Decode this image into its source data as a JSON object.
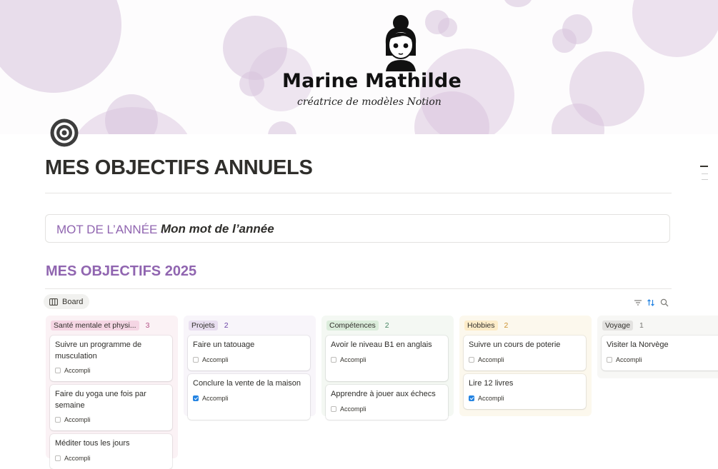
{
  "cover": {
    "logo_name": "Marine Mathilde",
    "logo_tagline": "créatrice de modèles Notion",
    "bubble_color": "#d7c2dc"
  },
  "page": {
    "icon": "target-icon",
    "title": "MES OBJECTIFS ANNUELS"
  },
  "callout": {
    "label": "MOT DE L’ANNÉE :",
    "value": "Mon mot de l’année"
  },
  "section": {
    "heading": "MES OBJECTIFS 2025",
    "accent_color": "#9065b0"
  },
  "view": {
    "tab_label": "Board",
    "tab_icon": "board-icon",
    "tools": [
      "filter-icon",
      "sort-icon",
      "search-icon"
    ]
  },
  "columns": [
    {
      "name": "Santé mentale et physi...",
      "count": "3",
      "tag_bg": "#f5d6e4",
      "col_bg": "#fbf2f5",
      "count_color": "#b35488",
      "cards": [
        {
          "title": "Suivre un programme de musculation",
          "check_label": "Accompli",
          "checked": false
        },
        {
          "title": "Faire du yoga une fois par semaine",
          "check_label": "Accompli",
          "checked": false
        },
        {
          "title": "Méditer tous les jours",
          "check_label": "Accompli",
          "checked": false
        }
      ]
    },
    {
      "name": "Projets",
      "count": "2",
      "tag_bg": "#e8def0",
      "col_bg": "#f8f5fa",
      "count_color": "#6940a5",
      "cards": [
        {
          "title": "Faire un tatouage",
          "check_label": "Accompli",
          "checked": false
        },
        {
          "title": "Conclure la vente de la maison",
          "check_label": "Accompli",
          "checked": true
        }
      ]
    },
    {
      "name": "Compétences",
      "count": "2",
      "tag_bg": "#dbeddb",
      "col_bg": "#f4f8f3",
      "count_color": "#448361",
      "cards": [
        {
          "title": "Avoir le niveau B1 en anglais",
          "check_label": "Accompli",
          "checked": false
        },
        {
          "title": "Apprendre à jouer aux échecs",
          "check_label": "Accompli",
          "checked": false
        }
      ]
    },
    {
      "name": "Hobbies",
      "count": "2",
      "tag_bg": "#fdecc8",
      "col_bg": "#fcf8ed",
      "count_color": "#cb912f",
      "cards": [
        {
          "title": "Suivre un cours de poterie",
          "check_label": "Accompli",
          "checked": false
        },
        {
          "title": "Lire 12 livres",
          "check_label": "Accompli",
          "checked": true
        }
      ]
    },
    {
      "name": "Voyage",
      "count": "1",
      "tag_bg": "#e3e2e0",
      "col_bg": "#f7f7f5",
      "count_color": "#787774",
      "cards": [
        {
          "title": "Visiter la Norvège",
          "check_label": "Accompli",
          "checked": false
        }
      ]
    }
  ]
}
